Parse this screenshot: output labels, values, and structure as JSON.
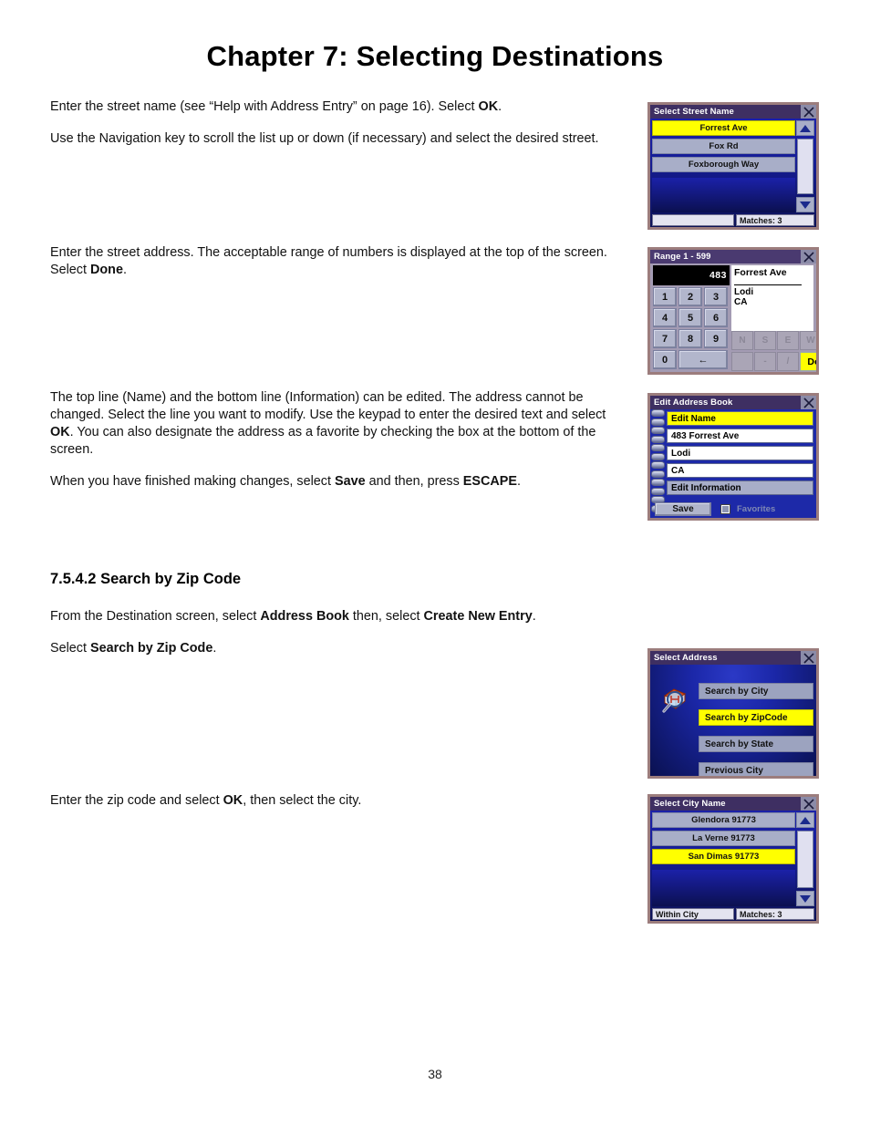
{
  "page": {
    "title": "Chapter 7: Selecting Destinations",
    "number": "38"
  },
  "body": {
    "p1_a": "Enter the street name (see “Help with Address Entry” on page 16). Select ",
    "p1_b": "OK",
    "p1_c": ".",
    "p2": "Use the Navigation key to scroll the list up or down (if necessary) and select the desired street.",
    "p3_a": "Enter the street address. The acceptable range of numbers is displayed at the top of the screen. Select ",
    "p3_b": "Done",
    "p3_c": ".",
    "p4_a": "The top line (Name) and the bottom line (Information) can be edited. The address cannot be changed. Select the line you want to modify. Use the keypad to enter the desired text and select ",
    "p4_b": "OK",
    "p4_c": ". You can also designate the address as a favorite by checking the box at the bottom of the screen.",
    "p5_a": "When you have finished making changes, select ",
    "p5_b": "Save",
    "p5_c": " and then, press ",
    "p5_d": "ESCAPE",
    "p5_e": ".",
    "section_number": "7.5.4.2",
    "section_title": "Search by Zip Code",
    "p6_a": "From the Destination screen, select ",
    "p6_b": "Address Book",
    "p6_c": " then, select ",
    "p6_d": "Create New Entry",
    "p6_e": ".",
    "p7_a": "Select ",
    "p7_b": "Search by Zip Code",
    "p7_c": ".",
    "p8_a": "Enter the zip code and select ",
    "p8_b": "OK",
    "p8_c": ", then select the city."
  },
  "screens": {
    "street_name": {
      "title": "Select Street Name",
      "rows": [
        {
          "label": "Forrest Ave",
          "selected": true
        },
        {
          "label": "Fox Rd",
          "selected": false
        },
        {
          "label": "Foxborough Way",
          "selected": false
        }
      ],
      "status_left": "",
      "status_right": "Matches:  3"
    },
    "range": {
      "title": "Range 1 - 599",
      "display_value": "483",
      "info_name": "Forrest Ave",
      "info_city": "Lodi",
      "info_state": "CA",
      "keys": [
        "1",
        "2",
        "3",
        "4",
        "5",
        "6",
        "7",
        "8",
        "9",
        "0"
      ],
      "backspace": "←",
      "dir_keys": [
        "N",
        "S",
        "E",
        "W"
      ],
      "sym_keys": [
        "-",
        "/"
      ],
      "done_label": "Done"
    },
    "edit_address_book": {
      "title": "Edit Address Book",
      "rows": [
        {
          "label": "Edit Name",
          "style": "yellow"
        },
        {
          "label": "483 Forrest Ave",
          "style": "white"
        },
        {
          "label": "Lodi",
          "style": "white"
        },
        {
          "label": "CA",
          "style": "white"
        },
        {
          "label": "Edit Information",
          "style": "grey"
        }
      ],
      "save_label": "Save",
      "favorites_label": "Favorites"
    },
    "select_address": {
      "title": "Select Address",
      "items": [
        {
          "label": "Search by City",
          "selected": false
        },
        {
          "label": "Search by ZipCode",
          "selected": true
        },
        {
          "label": "Search by State",
          "selected": false
        },
        {
          "label": "Previous City",
          "selected": false
        }
      ]
    },
    "city_name": {
      "title": "Select City Name",
      "rows": [
        {
          "label": "Glendora 91773",
          "selected": false
        },
        {
          "label": "La Verne 91773",
          "selected": false
        },
        {
          "label": "San Dimas 91773",
          "selected": true
        }
      ],
      "status_left": "Within City",
      "status_right": "Matches:  3"
    }
  },
  "colors": {
    "highlight": "#ffff00",
    "titlebar": "#3e2f62",
    "screen_bg": "#1b21a8",
    "bezel": "#9c7d7d"
  }
}
